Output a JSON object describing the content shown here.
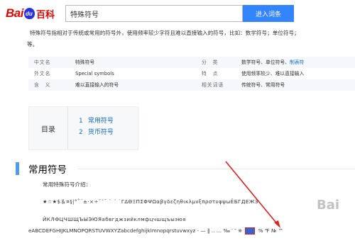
{
  "header": {
    "logo_bai": "Bai",
    "logo_ke": "百科",
    "search_value": "特殊符号",
    "search_button": "进入词条"
  },
  "intro": {
    "line1": "特殊符号指相对于传统或常用的符号外，使用频率较少字符且难以直接输入的符号，比如：数学符号；单位符号；",
    "line2": "等。"
  },
  "info": {
    "rows": [
      {
        "k1": "中文名",
        "v1": "特殊符号",
        "k2": "分　类",
        "v2": "数学符号、单位符号、",
        "v2_link": "制表符"
      },
      {
        "k1": "外文名",
        "v1": "Special symbols",
        "k2": "特　点",
        "v2": "使用频率较少、难以直接输入",
        "v2_link": ""
      },
      {
        "k1": "含　义",
        "v1": "难以直接输入的符号",
        "k2": "相关词语",
        "v2": "传统符号、常用符号",
        "v2_link": ""
      }
    ]
  },
  "toc": {
    "title": "目录",
    "items": [
      {
        "num": "1",
        "label": "常用符号"
      },
      {
        "num": "2",
        "label": "货币符号"
      }
    ]
  },
  "section": {
    "title": "常用符号",
    "lead": "常用特殊符号介绍：",
    "line_a": "★☆★$＆¤§|°˚¨±·×÷ˇ˘ˉ ˋ ˊ ˙ΓΔΘΞΠΣΦΨΩαβγδεζηθικλμνξπρστυφψωЁБГДЕЖЗ",
    "line_b": "ЙКЛФЦЧШЩЪЫЭЮЯабвгджзийклмфцчшщъыэюя",
    "line_c_pre": "eABCDEFGHIJKLMNOPQRSTUVWXYZabcdefghijklmnopqrstuvwxyz - — ‖ ‥ … ‰ ′ ″ ※",
    "line_c_post": "% ℉ № ™"
  },
  "watermark": {
    "glyph": "Bai"
  }
}
